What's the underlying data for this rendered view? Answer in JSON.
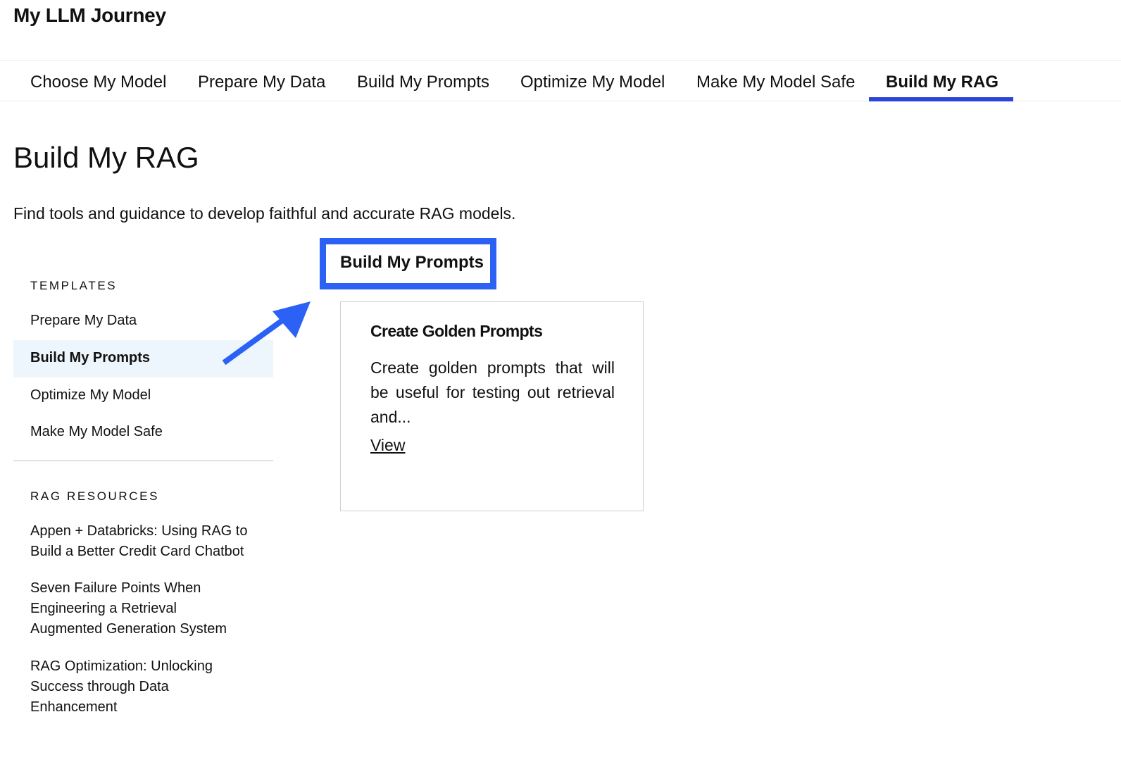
{
  "app": {
    "title": "My LLM Journey"
  },
  "tabs": [
    {
      "label": "Choose My Model",
      "active": false
    },
    {
      "label": "Prepare My Data",
      "active": false
    },
    {
      "label": "Build My Prompts",
      "active": false
    },
    {
      "label": "Optimize My Model",
      "active": false
    },
    {
      "label": "Make My Model Safe",
      "active": false
    },
    {
      "label": "Build My RAG",
      "active": true
    }
  ],
  "page": {
    "title": "Build My RAG",
    "description": "Find tools and guidance to develop faithful and accurate RAG models."
  },
  "sidebar": {
    "templates_heading": "TEMPLATES",
    "templates": [
      {
        "label": "Prepare My Data",
        "active": false
      },
      {
        "label": "Build My Prompts",
        "active": true
      },
      {
        "label": "Optimize My Model",
        "active": false
      },
      {
        "label": "Make My Model Safe",
        "active": false
      }
    ],
    "resources_heading": "RAG RESOURCES",
    "resources": [
      {
        "label": "Appen + Databricks: Using RAG to Build a Better Credit Card Chatbot"
      },
      {
        "label": "Seven Failure Points When Engineering a Retrieval Augmented Generation System"
      },
      {
        "label": "RAG Optimization: Unlocking Success through Data Enhancement"
      }
    ]
  },
  "section": {
    "heading": "Build My Prompts",
    "highlight_color": "#2b62f5"
  },
  "card": {
    "title": "Create Golden Prompts",
    "description": "Create golden prompts that will be useful for testing out retrieval and...",
    "link_label": "View"
  },
  "colors": {
    "accent_tab_underline": "#2b45d4",
    "annotation_blue": "#2b62f5",
    "sidebar_active_bg": "#eef6fd"
  }
}
